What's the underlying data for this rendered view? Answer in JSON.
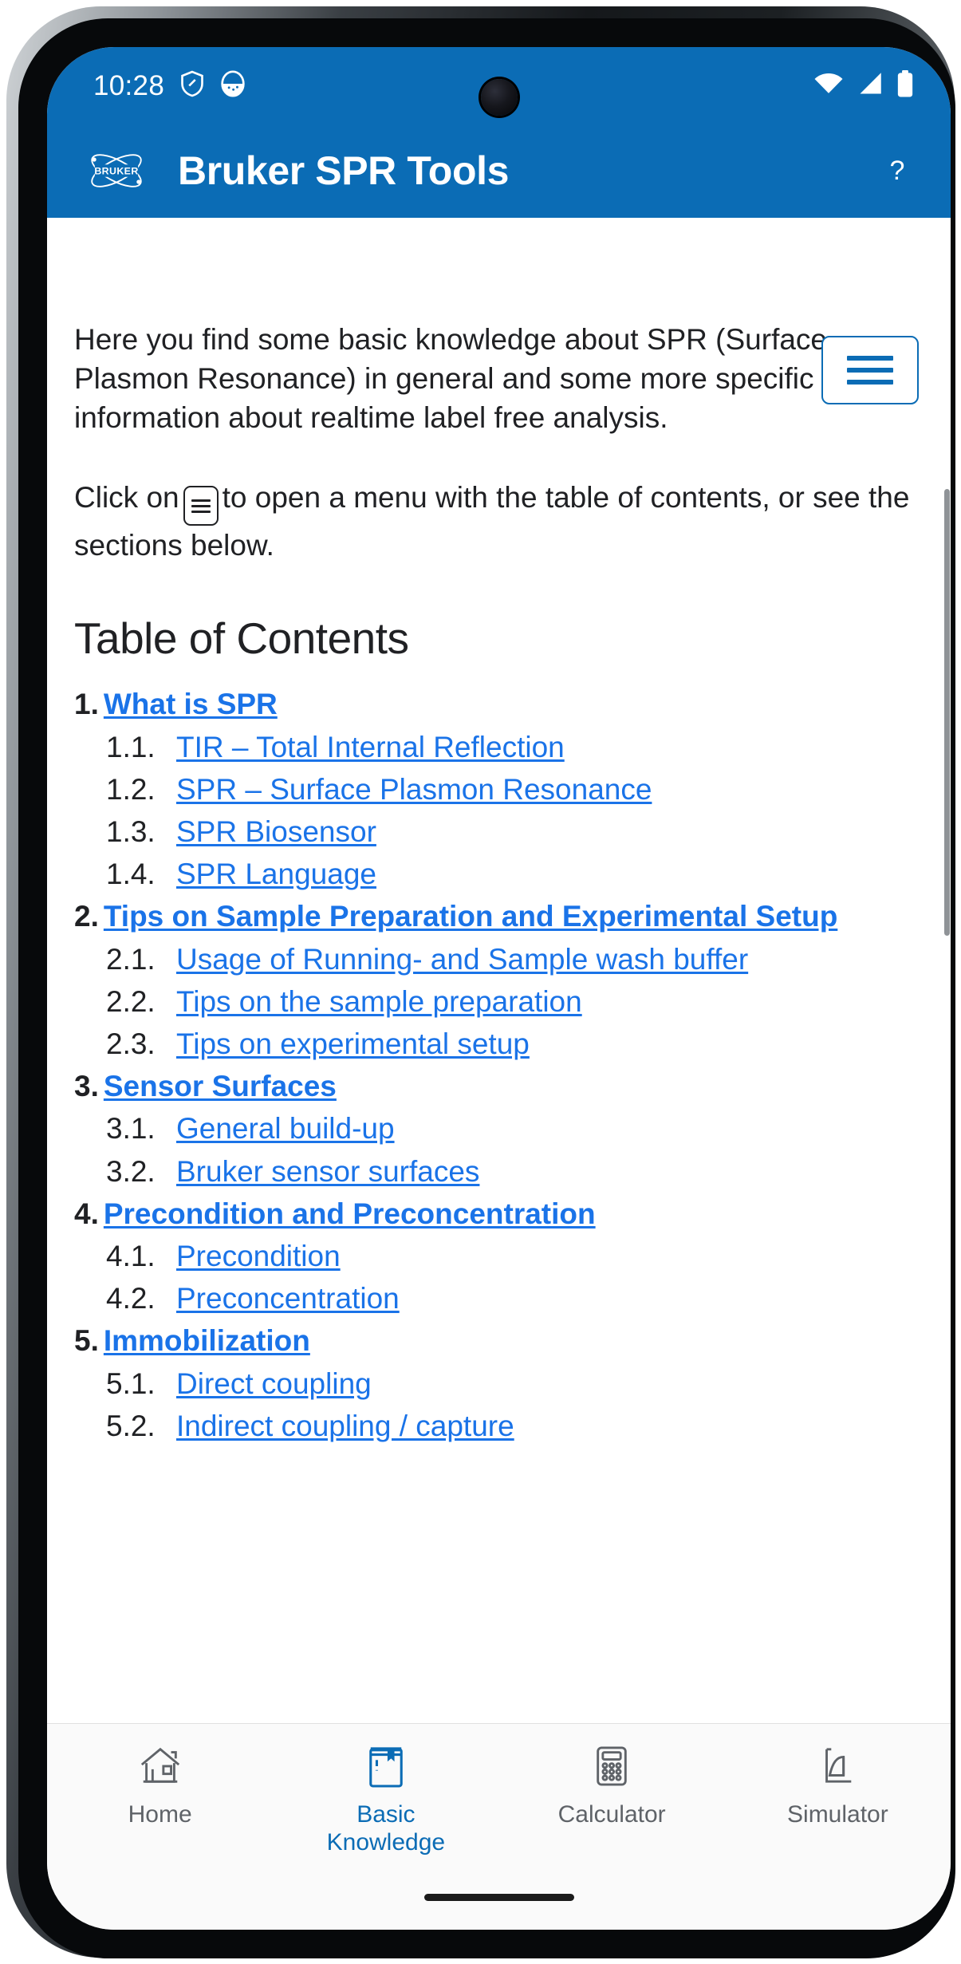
{
  "status_bar": {
    "time": "10:28",
    "icons": [
      "shield-icon",
      "app-notification-icon"
    ],
    "right_icons": [
      "wifi-icon",
      "signal-icon",
      "battery-icon"
    ]
  },
  "app_bar": {
    "logo": "bruker-logo",
    "title": "Bruker SPR Tools",
    "help_label": "?"
  },
  "content": {
    "menu_button": "hamburger-menu-icon",
    "paragraph_1": "Here you find some basic knowledge about SPR (Surface Plasmon Resonance) in general and some more specific information about realtime label free analysis.",
    "paragraph_2_before": "Click on",
    "paragraph_2_after": "to open a menu with the table of contents, or see the sections below.",
    "toc_heading": "Table of Contents",
    "toc": [
      {
        "num": "1.",
        "label": "What is SPR",
        "children": [
          {
            "num": "1.1.",
            "label": "TIR – Total Internal Reflection"
          },
          {
            "num": "1.2.",
            "label": "SPR – Surface Plasmon Resonance"
          },
          {
            "num": "1.3.",
            "label": "SPR Biosensor"
          },
          {
            "num": "1.4.",
            "label": "SPR Language"
          }
        ]
      },
      {
        "num": "2.",
        "label": "Tips on Sample Preparation and Experimental Setup",
        "children": [
          {
            "num": "2.1.",
            "label": "Usage of Running- and Sample wash buffer"
          },
          {
            "num": "2.2.",
            "label": "Tips on the sample preparation"
          },
          {
            "num": "2.3.",
            "label": "Tips on experimental setup"
          }
        ]
      },
      {
        "num": "3.",
        "label": "Sensor Surfaces",
        "children": [
          {
            "num": "3.1.",
            "label": "General build-up"
          },
          {
            "num": "3.2.",
            "label": "Bruker sensor surfaces"
          }
        ]
      },
      {
        "num": "4.",
        "label": "Precondition and Preconcentration",
        "children": [
          {
            "num": "4.1.",
            "label": "Precondition"
          },
          {
            "num": "4.2.",
            "label": "Preconcentration"
          }
        ]
      },
      {
        "num": "5.",
        "label": "Immobilization",
        "children": [
          {
            "num": "5.1.",
            "label": "Direct coupling"
          },
          {
            "num": "5.2.",
            "label": "Indirect coupling / capture"
          }
        ]
      }
    ]
  },
  "bottom_nav": {
    "items": [
      {
        "label": "Home",
        "icon": "home-icon",
        "active": false
      },
      {
        "label": "Basic\nKnowledge",
        "label_line1": "Basic",
        "label_line2": "Knowledge",
        "icon": "book-icon",
        "active": true
      },
      {
        "label": "Calculator",
        "icon": "calculator-icon",
        "active": false
      },
      {
        "label": "Simulator",
        "icon": "simulator-chart-icon",
        "active": false
      }
    ]
  },
  "colors": {
    "brand_blue": "#0b6cb5",
    "link_blue": "#1a73e8",
    "text_dark": "#202124",
    "nav_inactive": "#5f6368"
  }
}
